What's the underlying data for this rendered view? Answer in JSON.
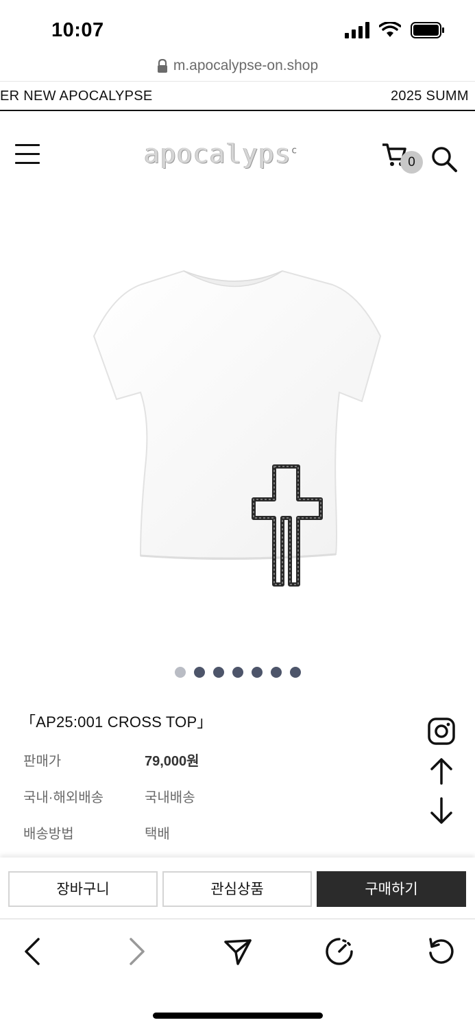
{
  "status": {
    "time": "10:07"
  },
  "browser": {
    "url": "m.apocalypse-on.shop"
  },
  "marquee": {
    "left_text": "ER NEW APOCALYPSE",
    "right_text": "2025 SUMM"
  },
  "header": {
    "logo_text": "apocalyps",
    "logo_mark": "c",
    "cart_count": "0"
  },
  "gallery": {
    "dot_count": 7,
    "active_index": 0
  },
  "product": {
    "title": "「AP25:001 CROSS TOP」",
    "rows": [
      {
        "label": "판매가",
        "value": "79,000원"
      },
      {
        "label": "국내·해외배송",
        "value": "국내배송"
      },
      {
        "label": "배송방법",
        "value": "택배"
      }
    ]
  },
  "actions": {
    "cart": "장바구니",
    "wishlist": "관심상품",
    "buy": "구매하기"
  },
  "icons": [
    "menu-icon",
    "cart-icon",
    "search-icon",
    "instagram-icon",
    "arrow-up-icon",
    "arrow-down-icon",
    "back-icon",
    "forward-icon",
    "share-icon",
    "speed-icon",
    "reload-icon",
    "lock-icon"
  ],
  "colors": {
    "buy_button": "#2b2b2b",
    "dot_active": "#b9bcc4",
    "dot": "#4d556a"
  }
}
